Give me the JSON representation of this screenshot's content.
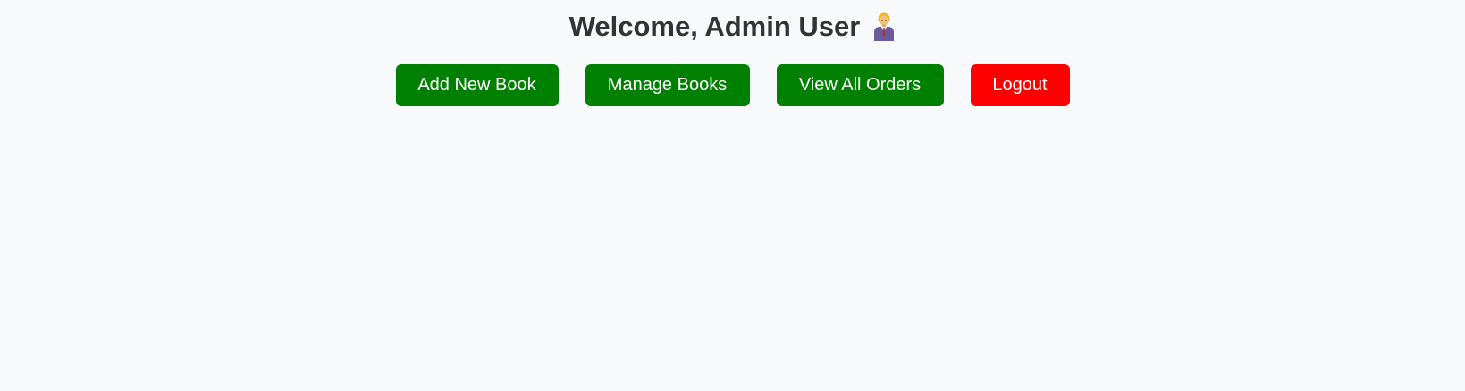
{
  "header": {
    "title": "Welcome, Admin User",
    "icon": "office-worker-icon"
  },
  "actions": {
    "add_book_label": "Add New Book",
    "manage_books_label": "Manage Books",
    "view_orders_label": "View All Orders",
    "logout_label": "Logout"
  },
  "colors": {
    "background": "#f8f9fb",
    "primary_button": "#008000",
    "danger_button": "#ff0000",
    "title_text": "#333333",
    "button_text": "#ffffff"
  }
}
